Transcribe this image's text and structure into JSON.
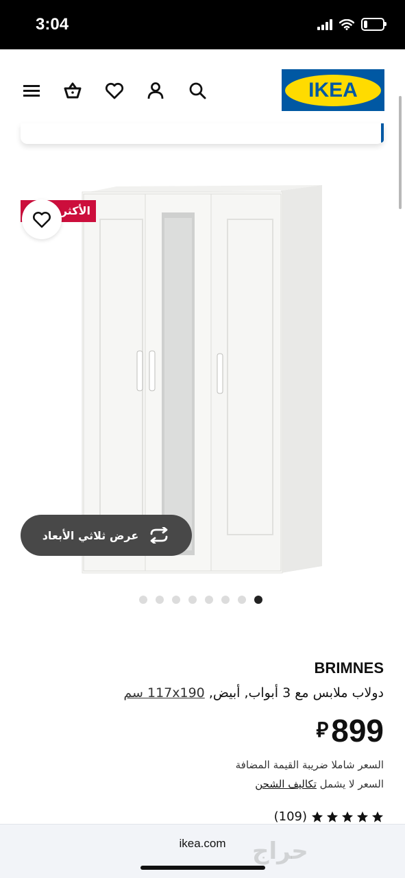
{
  "status_bar": {
    "time": "3:04"
  },
  "header": {
    "logo_text": "IKEA",
    "icons": [
      "menu-icon",
      "basket-icon",
      "heart-icon",
      "user-icon",
      "search-icon"
    ],
    "colors": {
      "brand_blue": "#0058a3",
      "brand_yellow": "#ffdb00"
    }
  },
  "product": {
    "badge": "الأكثر",
    "view_3d_label": "عرض ثلاثي الأبعاد",
    "carousel": {
      "total_images": 8,
      "active_index": 8
    },
    "brand": "BRIMNES",
    "description": "دولاب ملابس مع 3 أبواب, أبيض, ",
    "dimensions": "117x190 سم",
    "price": "899",
    "currency_symbol": "⃁",
    "vat_note": "السعر شاملا ضريبة القيمة المضافة",
    "shipping_prefix": "السعر لا يشمل ",
    "shipping_link": "تكاليف الشحن",
    "rating_count": "(109)",
    "rating_stars": 5,
    "badge_color": "#cc0e3c"
  },
  "browser": {
    "url": "ikea.com",
    "watermark": "حراج"
  }
}
